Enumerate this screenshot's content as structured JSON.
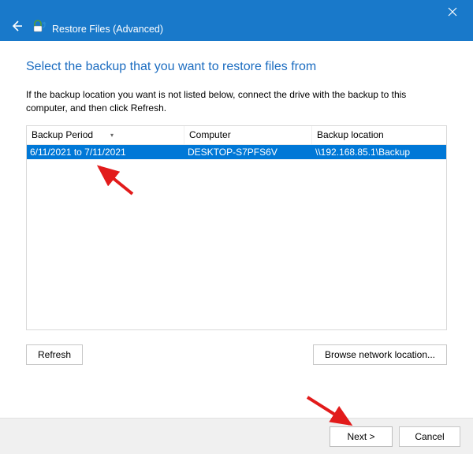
{
  "titlebar": {
    "title": "Restore Files (Advanced)"
  },
  "heading": "Select the backup that you want to restore files from",
  "instruction": "If the backup location you want is not listed below, connect the drive with the backup to this computer, and then click Refresh.",
  "columns": {
    "period": "Backup Period",
    "computer": "Computer",
    "location": "Backup location"
  },
  "rows": [
    {
      "period": "6/11/2021 to 7/11/2021",
      "computer": "DESKTOP-S7PFS6V",
      "location": "\\\\192.168.85.1\\Backup"
    }
  ],
  "buttons": {
    "refresh": "Refresh",
    "browse": "Browse network location...",
    "next": "Next >",
    "cancel": "Cancel"
  }
}
